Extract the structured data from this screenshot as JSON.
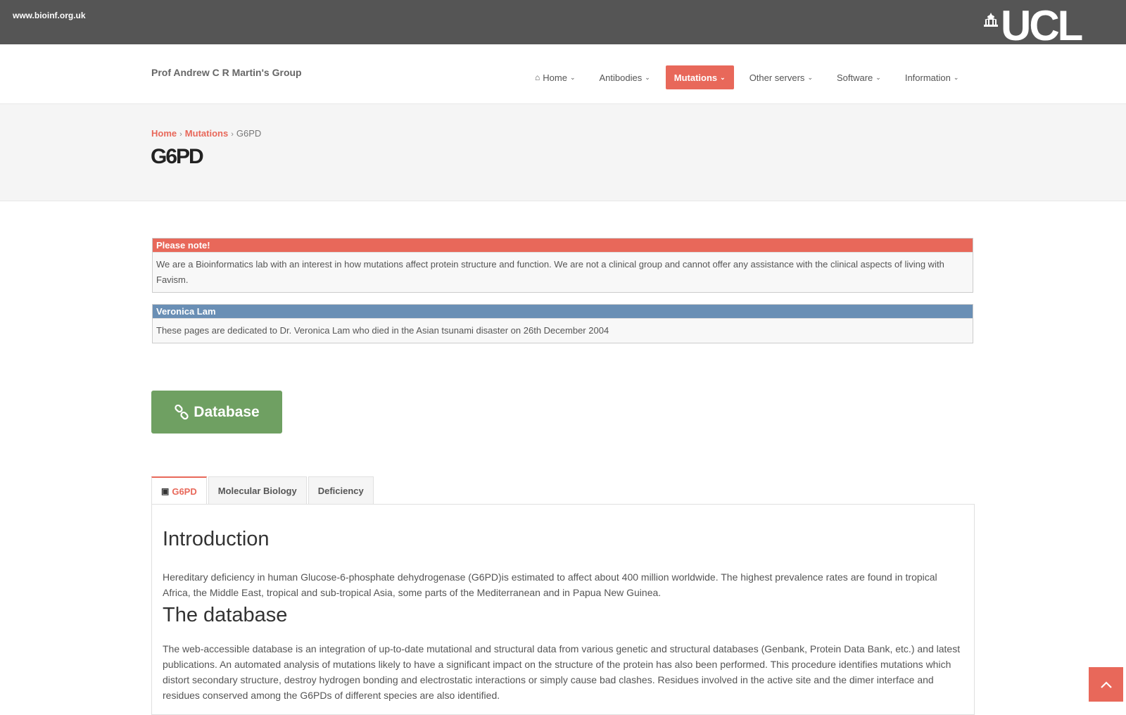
{
  "topbar": {
    "site": "www.bioinf.org.uk",
    "logo_text": "UCL"
  },
  "header": {
    "brand": "Prof Andrew C R Martin's Group",
    "nav": [
      {
        "label": "Home",
        "icon": "home-icon",
        "active": false
      },
      {
        "label": "Antibodies",
        "active": false
      },
      {
        "label": "Mutations",
        "active": true
      },
      {
        "label": "Other servers",
        "active": false
      },
      {
        "label": "Software",
        "active": false
      },
      {
        "label": "Information",
        "active": false
      }
    ]
  },
  "breadcrumb": {
    "home": "Home",
    "mutations": "Mutations",
    "current": "G6PD"
  },
  "page_title": "G6PD",
  "notices": {
    "note_title": "Please note!",
    "note_body": "We are a Bioinformatics lab with an interest in how mutations affect protein structure and function. We are not a clinical group and cannot offer any assistance with the clinical aspects of living with Favism.",
    "dedication_title": "Veronica Lam",
    "dedication_body": "These pages are dedicated to Dr. Veronica Lam who died in the Asian tsunami disaster on 26th December 2004"
  },
  "database_button": "Database",
  "tabs": [
    {
      "label": "G6PD",
      "active": true
    },
    {
      "label": "Molecular Biology",
      "active": false
    },
    {
      "label": "Deficiency",
      "active": false
    }
  ],
  "content": {
    "intro_heading": "Introduction",
    "intro_text": "Hereditary deficiency in human Glucose-6-phosphate dehydrogenase (G6PD)is estimated to affect about 400 million worldwide. The highest prevalence rates are found in tropical Africa, the Middle East, tropical and sub-tropical Asia, some parts of the Mediterranean and in Papua New Guinea.",
    "db_heading": "The database",
    "db_text": "The web-accessible database is an integration of up-to-date mutational and structural data from various genetic and structural databases (Genbank, Protein Data Bank, etc.) and latest publications. An automated analysis of mutations likely to have a significant impact on the structure of the protein has also been performed. This procedure identifies mutations which distort secondary structure, destroy hydrogen bonding and electrostatic interactions or simply cause bad clashes. Residues involved in the active site and the dimer interface and residues conserved among the G6PDs of different species are also identified."
  },
  "colors": {
    "accent": "#e8685a",
    "topbar": "#555555",
    "dedication": "#6a8fb5",
    "database_button": "#6fa062"
  }
}
